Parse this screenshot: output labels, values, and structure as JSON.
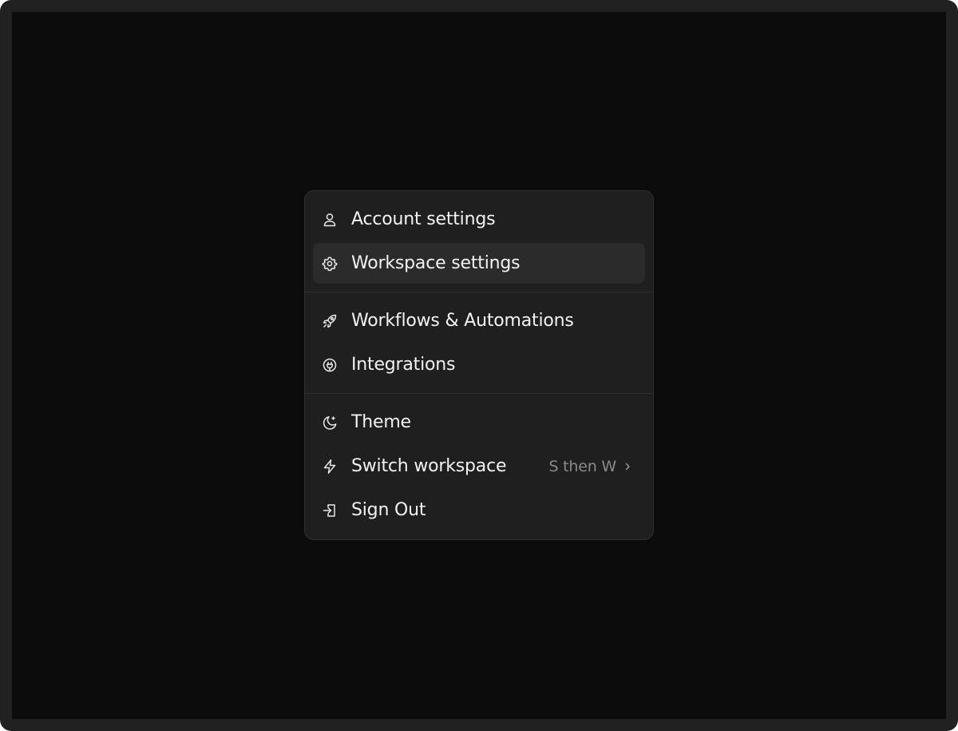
{
  "menu": {
    "groups": [
      {
        "items": [
          {
            "label": "Account settings",
            "icon": "user-icon"
          },
          {
            "label": "Workspace settings",
            "icon": "gear-icon",
            "highlighted": true
          }
        ]
      },
      {
        "items": [
          {
            "label": "Workflows & Automations",
            "icon": "rocket-icon"
          },
          {
            "label": "Integrations",
            "icon": "plug-icon"
          }
        ]
      },
      {
        "items": [
          {
            "label": "Theme",
            "icon": "moon-icon"
          },
          {
            "label": "Switch workspace",
            "icon": "lightning-icon",
            "shortcut": "S then W"
          },
          {
            "label": "Sign Out",
            "icon": "sign-out-icon"
          }
        ]
      }
    ]
  },
  "colors": {
    "frame": "#212121",
    "screen": "#0c0c0c",
    "menu_bg": "#1f1f1f",
    "highlight": "#2b2b2b",
    "text": "#f2f2f2",
    "muted": "#8a8a8a"
  }
}
